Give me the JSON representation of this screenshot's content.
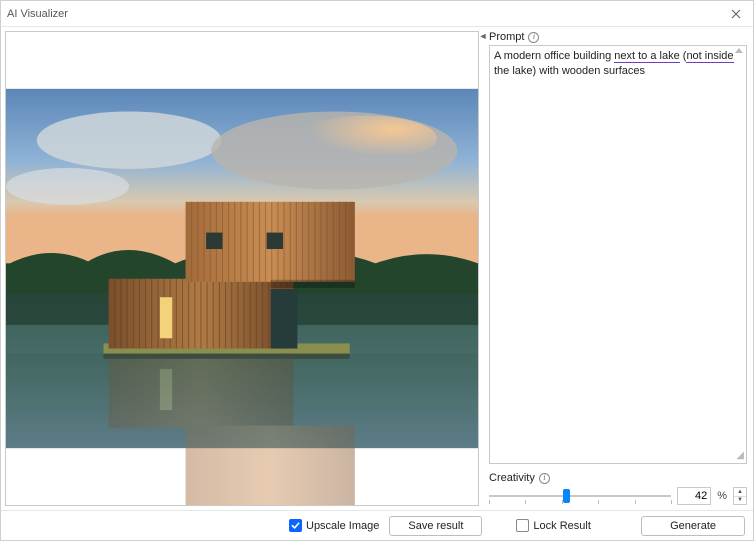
{
  "window": {
    "title": "AI Visualizer"
  },
  "prompt": {
    "label": "Prompt",
    "seg1": "A modern office building ",
    "seg2_ul": "next to a lake",
    "seg3": " (",
    "seg4_ul": "not inside",
    "seg5": " the lake) with wooden surfaces"
  },
  "creativity": {
    "label": "Creativity",
    "value": "42",
    "percent_symbol": "%",
    "thumb_percent": 42,
    "ticks": [
      0,
      20,
      40,
      60,
      80,
      100
    ]
  },
  "footer": {
    "upscale_label": "Upscale Image",
    "upscale_checked": true,
    "save_label": "Save result",
    "lock_label": "Lock Result",
    "lock_checked": false,
    "generate_label": "Generate"
  }
}
